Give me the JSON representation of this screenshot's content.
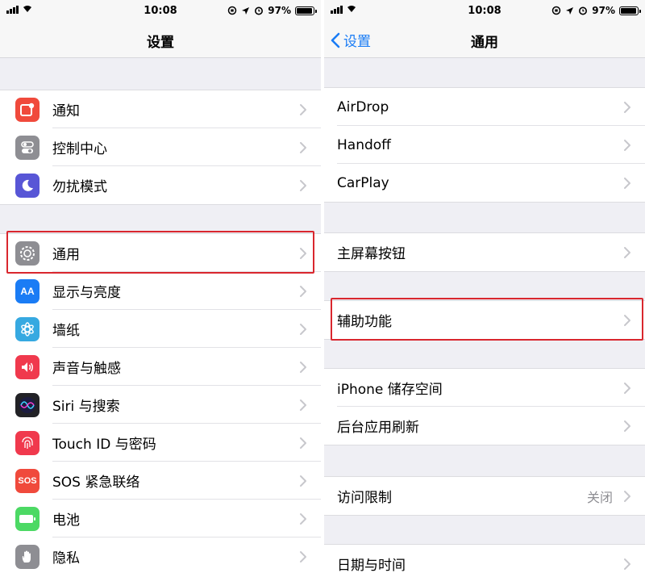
{
  "status": {
    "time": "10:08",
    "battery": "97%",
    "battery_level": 0.97
  },
  "left": {
    "title": "设置",
    "groups": [
      [
        {
          "label": "通知",
          "icon": "notifications-icon",
          "color": "#f04a3c"
        },
        {
          "label": "控制中心",
          "icon": "control-center-icon",
          "color": "#8e8e93"
        },
        {
          "label": "勿扰模式",
          "icon": "do-not-disturb-icon",
          "color": "#5856d6"
        }
      ],
      [
        {
          "label": "通用",
          "icon": "gear-icon",
          "color": "#8e8e93",
          "highlighted": true
        },
        {
          "label": "显示与亮度",
          "icon": "display-brightness-icon",
          "color": "#1a7cf5"
        },
        {
          "label": "墙纸",
          "icon": "wallpaper-icon",
          "color": "#36a9e1"
        },
        {
          "label": "声音与触感",
          "icon": "sounds-icon",
          "color": "#f0394d"
        },
        {
          "label": "Siri 与搜索",
          "icon": "siri-icon",
          "color": "#222226"
        },
        {
          "label": "Touch ID 与密码",
          "icon": "fingerprint-icon",
          "color": "#f0394d"
        },
        {
          "label": "SOS 紧急联络",
          "icon": "sos-icon",
          "color": "#f04a3c",
          "icon_text": "SOS"
        },
        {
          "label": "电池",
          "icon": "battery-icon",
          "color": "#4cd964"
        },
        {
          "label": "隐私",
          "icon": "privacy-hand-icon",
          "color": "#8e8e93"
        }
      ]
    ]
  },
  "right": {
    "back_label": "设置",
    "title": "通用",
    "groups": [
      [
        {
          "label": "AirDrop"
        },
        {
          "label": "Handoff"
        },
        {
          "label": "CarPlay"
        }
      ],
      [
        {
          "label": "主屏幕按钮"
        }
      ],
      [
        {
          "label": "辅助功能",
          "highlighted": true
        }
      ],
      [
        {
          "label": "iPhone 储存空间"
        },
        {
          "label": "后台应用刷新"
        }
      ],
      [
        {
          "label": "访问限制",
          "value": "关闭"
        }
      ],
      [
        {
          "label": "日期与时间"
        }
      ]
    ]
  },
  "colors": {
    "accent": "#1a7cf5",
    "highlight": "#d9272e"
  }
}
